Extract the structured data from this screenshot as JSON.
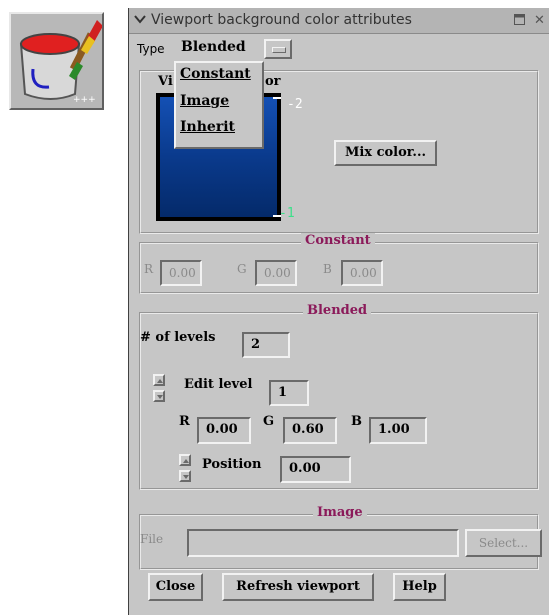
{
  "app_icon": {
    "name": "paint-bucket-brush-icon"
  },
  "window": {
    "title": "Viewport background color attributes",
    "type_label": "Type",
    "type_value": "Blended",
    "menu_items": [
      "Constant",
      "Image",
      "Inherit"
    ],
    "color_frame_label": "Viewport color",
    "color_frame_label_visible": "Vi",
    "color_frame_label_tail": "or",
    "gradient": {
      "top_color": "#1450b4",
      "bottom_color": "#042a6a",
      "top_label": "-2",
      "bottom_label": "-1"
    },
    "mix_color_button": "Mix color...",
    "constant": {
      "title": "Constant",
      "r_label": "R",
      "r_value": "0.00",
      "g_label": "G",
      "g_value": "0.00",
      "b_label": "B",
      "b_value": "0.00"
    },
    "blended": {
      "title": "Blended",
      "levels_label": "# of levels",
      "levels_value": "2",
      "edit_level_label": "Edit level",
      "edit_level_value": "1",
      "r_label": "R",
      "r_value": "0.00",
      "g_label": "G",
      "g_value": "0.60",
      "b_label": "B",
      "b_value": "1.00",
      "position_label": "Position",
      "position_value": "0.00"
    },
    "image": {
      "title": "Image",
      "file_label": "File",
      "file_value": "",
      "select_button": "Select..."
    },
    "buttons": {
      "close": "Close",
      "refresh": "Refresh viewport",
      "help": "Help"
    }
  }
}
